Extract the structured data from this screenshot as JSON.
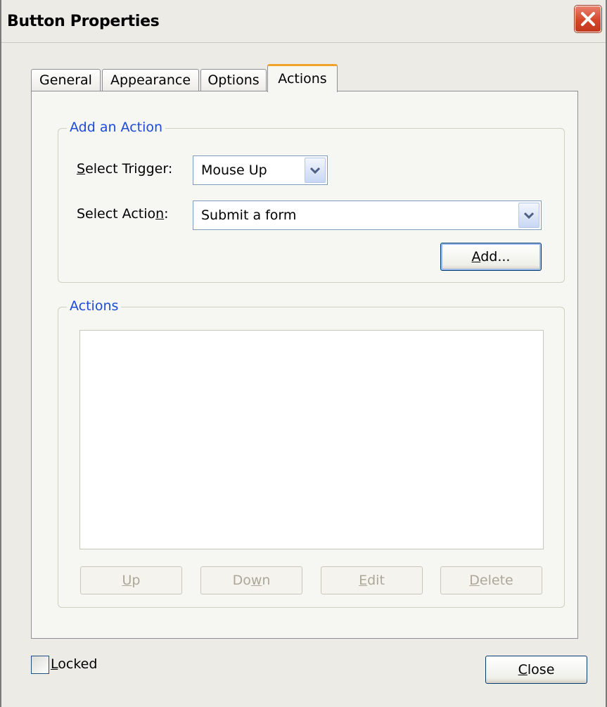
{
  "window": {
    "title": "Button Properties",
    "close_icon": "close-icon"
  },
  "tabs": [
    {
      "label": "General",
      "active": false
    },
    {
      "label": "Appearance",
      "active": false
    },
    {
      "label": "Options",
      "active": false
    },
    {
      "label": "Actions",
      "active": true
    }
  ],
  "add_action": {
    "group_title": "Add an Action",
    "trigger_label": "Select Trigger:",
    "trigger_value": "Mouse Up",
    "action_label": "Select Action:",
    "action_value": "Submit a form",
    "add_button": "Add..."
  },
  "actions_group": {
    "group_title": "Actions",
    "items": [],
    "buttons": {
      "up": "Up",
      "down": "Down",
      "edit": "Edit",
      "delete": "Delete"
    }
  },
  "footer": {
    "locked_label": "Locked",
    "locked_checked": false,
    "close_button": "Close"
  },
  "colors": {
    "group_title": "#1c4bd6",
    "active_tab_accent": "#f0a22a",
    "close_button_red": "#d5462a"
  }
}
